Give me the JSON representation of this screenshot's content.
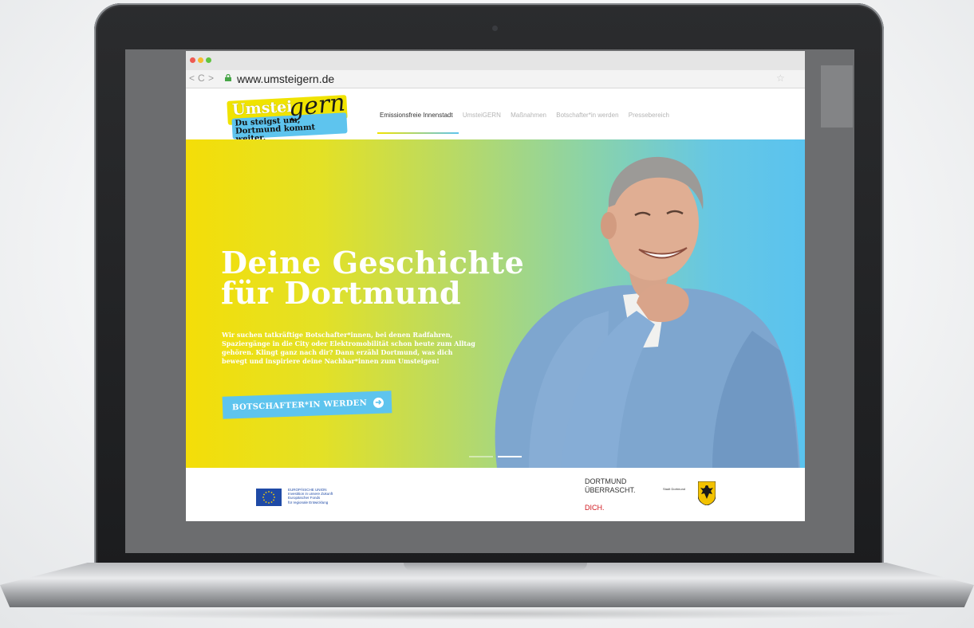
{
  "browser": {
    "url": "www.umsteigern.de",
    "nav_back": "<",
    "nav_reload": "C",
    "nav_forward": ">",
    "bookmark_icon": "☆"
  },
  "logo": {
    "word": "Umstei",
    "script": "gern",
    "tagline": "Du steigst um,\nDortmund kommt weiter."
  },
  "nav": {
    "items": [
      {
        "label": "Emissionsfreie Innenstadt",
        "active": true
      },
      {
        "label": "UmsteiGERN",
        "active": false
      },
      {
        "label": "Maßnahmen",
        "active": false
      },
      {
        "label": "Botschafter*in werden",
        "active": false
      },
      {
        "label": "Pressebereich",
        "active": false
      }
    ]
  },
  "hero": {
    "title": "Deine Geschichte\nfür Dortmund",
    "text": "Wir suchen tatkräftige Botschafter*innen, bei denen Radfahren, Spaziergänge in die City oder Elektromobilität schon heute zum Alltag gehören. Klingt ganz nach dir? Dann erzähl Dortmund, was dich bewegt und inspiriere deine Nachbar*innen zum Umsteigen!",
    "cta_label": "BOTSCHAFTER*IN WERDEN",
    "cta_icon": "arrow-right-circle-icon",
    "slides_total": 2,
    "slide_active": 2
  },
  "footer": {
    "eu_text": "EUROPÄISCHE UNION\nInvestition in unsere Zukunft\nEuropäischer Fonds\nfür regionale Entwicklung",
    "dortmund_text": "DORTMUND\nÜBERRASCHT.",
    "dortmund_dich": "DICH.",
    "stadt_label": "Stadt Dortmund"
  },
  "colors": {
    "brand_yellow": "#f0e300",
    "brand_blue": "#5ec4ee",
    "accent_red": "#d0181f"
  }
}
